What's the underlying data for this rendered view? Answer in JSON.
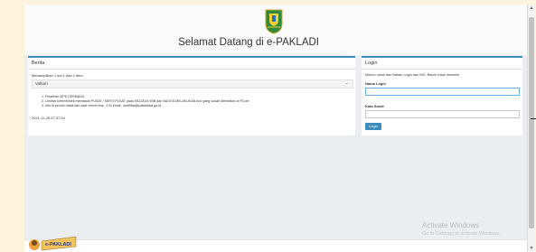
{
  "header": {
    "welcome": "Selamat Datang di e-PAKLADI"
  },
  "berita": {
    "title": "Berita",
    "showing": "Menampilkan 1 s/d 1 dari 1 item",
    "item_title": "Voltum",
    "collapse_symbol": "−",
    "notes": [
      "1. Pelatihan SIPK DERMAGA",
      "2. Lembar kemenristek memasuki PUSAT / SERTLPUSAT pada 9/11/2024 WIB dan NAGITA MELAKUKAN Anu yang sudah diterbitkan di PCore",
      "3. Info di penulu masa dan saat verkini Ima - 134 email : sertifikat@pakaldiwa.go.id"
    ],
    "timestamp": "2021-11-26 07:37:54"
  },
  "login": {
    "title": "Login",
    "info": "Mohon untuk dan Bahan Login dan NIS. Bandi untuk memulai",
    "username_label": "Nama Login",
    "username_value": "",
    "password_label": "Kata Sandi",
    "password_value": "",
    "button": "Login"
  },
  "watermark": {
    "line1": "Activate Windows",
    "line2": "Go to Settings to activate Windows."
  },
  "logo_text": "e-PAKLADI",
  "colors": {
    "accent": "#3c8dbc",
    "page_bg": "#ecedf0",
    "outer_bg": "#fdf3dc"
  },
  "icons": [
    "emblem-icon",
    "collapse-icon",
    "app-logo-icon",
    "scroll-up-icon",
    "scroll-down-icon"
  ]
}
